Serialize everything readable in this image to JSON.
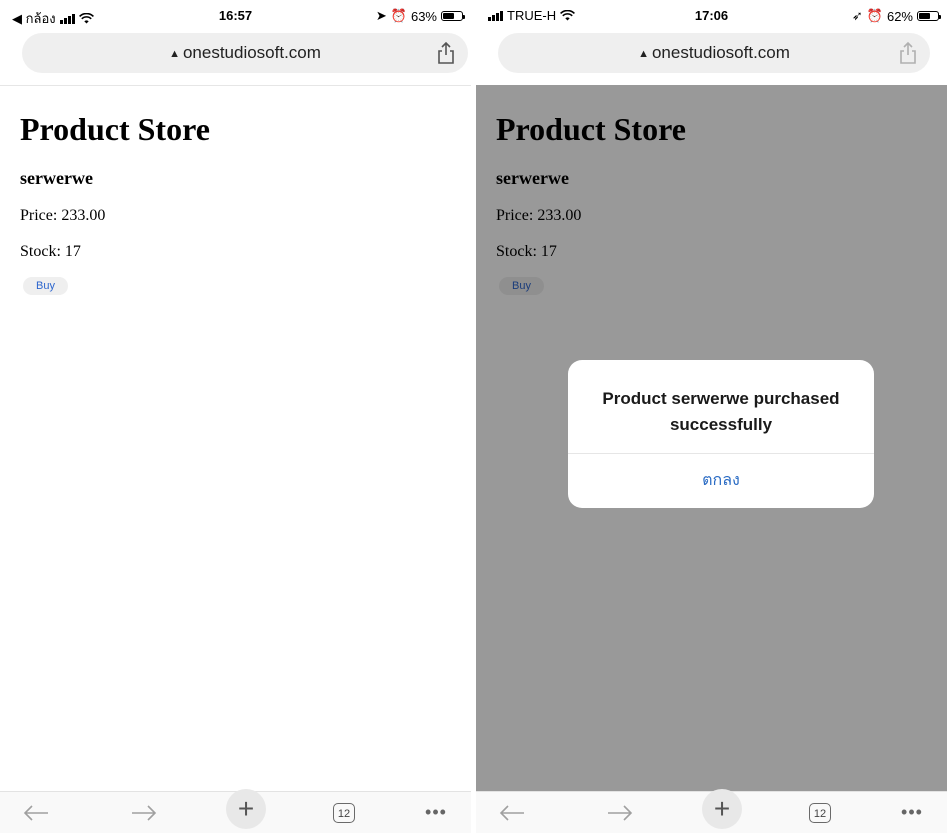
{
  "screens": [
    {
      "status": {
        "left_label": "◀ กล้อง",
        "time": "16:57",
        "battery": "63%",
        "battery_fraction": 0.63
      },
      "browser": {
        "url": "onestudiosoft.com",
        "tabs_count": "12"
      },
      "page": {
        "title": "Product Store",
        "product_name": "serwerwe",
        "price": "Price: 233.00",
        "stock": "Stock: 17",
        "buy_label": "Buy"
      }
    },
    {
      "status": {
        "left_label": "TRUE-H",
        "time": "17:06",
        "battery": "62%",
        "battery_fraction": 0.62
      },
      "browser": {
        "url": "onestudiosoft.com",
        "tabs_count": "12"
      },
      "page": {
        "title": "Product Store",
        "product_name": "serwerwe",
        "price": "Price: 233.00",
        "stock": "Stock: 17",
        "buy_label": "Buy"
      },
      "alert": {
        "message": "Product serwerwe purchased successfully",
        "ok_label": "ตกลง"
      }
    }
  ],
  "icons": {
    "url_prefix": "warning-triangle-icon",
    "share": "share-icon",
    "back": "arrow-left-icon",
    "forward": "arrow-right-icon",
    "new_tab": "plus-icon",
    "tabs": "tabs-count-icon",
    "more": "more-dots-icon"
  },
  "colors": {
    "link": "#2b6cc4",
    "buy_text": "#2d66ce",
    "overlay": "rgba(0,0,0,0.40)"
  }
}
